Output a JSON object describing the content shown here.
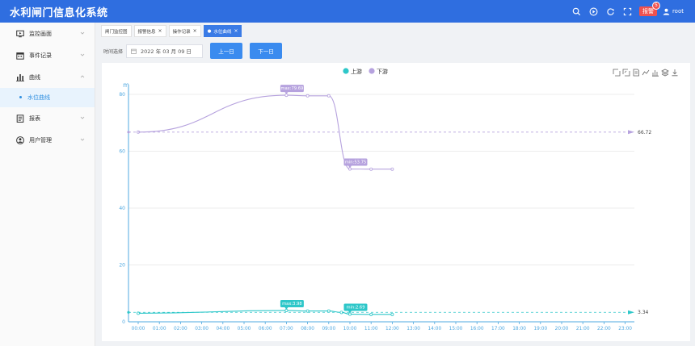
{
  "app": {
    "title": "水利闸门信息化系统"
  },
  "header": {
    "alarm_label": "报警",
    "alarm_count": "5",
    "user_name": "root",
    "icons": [
      "search-icon",
      "play-icon",
      "refresh-icon",
      "fullscreen-icon",
      "user-icon"
    ]
  },
  "sidebar": {
    "items": [
      {
        "label": "监控画面",
        "icon": "monitor-icon"
      },
      {
        "label": "事件记录",
        "icon": "calendar-icon"
      },
      {
        "label": "曲线",
        "icon": "bar-chart-icon"
      },
      {
        "label": "水位曲线",
        "icon": ""
      },
      {
        "label": "报表",
        "icon": "report-icon"
      },
      {
        "label": "用户管理",
        "icon": "user-manage-icon"
      }
    ]
  },
  "tabs": [
    {
      "label": "闸门监控图",
      "closable": false,
      "active": false
    },
    {
      "label": "报警信息",
      "closable": true,
      "active": false
    },
    {
      "label": "操作记录",
      "closable": true,
      "active": false
    },
    {
      "label": "水位曲线",
      "closable": true,
      "active": true
    }
  ],
  "filter": {
    "label": "时间选择",
    "date_value": "2022 年 03 月 09 日",
    "prev_label": "上一日",
    "next_label": "下一日"
  },
  "colors": {
    "header": "#2f6ee0",
    "upstream": "#2ec7c9",
    "downstream": "#b6a2de",
    "alarm": "#f0524f"
  },
  "chart_data": {
    "type": "line",
    "ylabel": "m",
    "ylim": [
      0,
      80
    ],
    "yticks": [
      0,
      20,
      40,
      60,
      80
    ],
    "categories": [
      "00:00",
      "01:00",
      "02:00",
      "03:00",
      "04:00",
      "05:00",
      "06:00",
      "07:00",
      "08:00",
      "09:00",
      "10:00",
      "11:00",
      "12:00",
      "13:00",
      "14:00",
      "15:00",
      "16:00",
      "17:00",
      "18:00",
      "19:00",
      "20:00",
      "21:00",
      "22:00",
      "23:00"
    ],
    "legend": [
      "上游",
      "下游"
    ],
    "series": [
      {
        "name": "上游",
        "color": "#2ec7c9",
        "points": [
          [
            0,
            3.0
          ],
          [
            7,
            3.98
          ],
          [
            8,
            3.8
          ],
          [
            9,
            3.8
          ],
          [
            9.6,
            3.3
          ],
          [
            10,
            2.69
          ],
          [
            11,
            2.6
          ],
          [
            12,
            2.6
          ]
        ],
        "max_label": "max:3.98",
        "min_label": "min:2.69",
        "max_at": 7,
        "min_at": 10,
        "average": 3.34,
        "average_label": "3.34"
      },
      {
        "name": "下游",
        "color": "#b6a2de",
        "points": [
          [
            0,
            66.72
          ],
          [
            7,
            79.69
          ],
          [
            8,
            79.5
          ],
          [
            9,
            79.5
          ],
          [
            10,
            53.75
          ],
          [
            11,
            53.7
          ],
          [
            12,
            53.7
          ]
        ],
        "max_label": "max:79.69",
        "min_label": "min:53.75",
        "max_at": 7,
        "min_at": 10,
        "average": 66.72,
        "average_label": "66.72"
      }
    ],
    "toolbox": [
      "zoom-icon",
      "zoom-reset-icon",
      "data-view-icon",
      "line-type-icon",
      "bar-type-icon",
      "stack-icon",
      "download-icon"
    ]
  }
}
